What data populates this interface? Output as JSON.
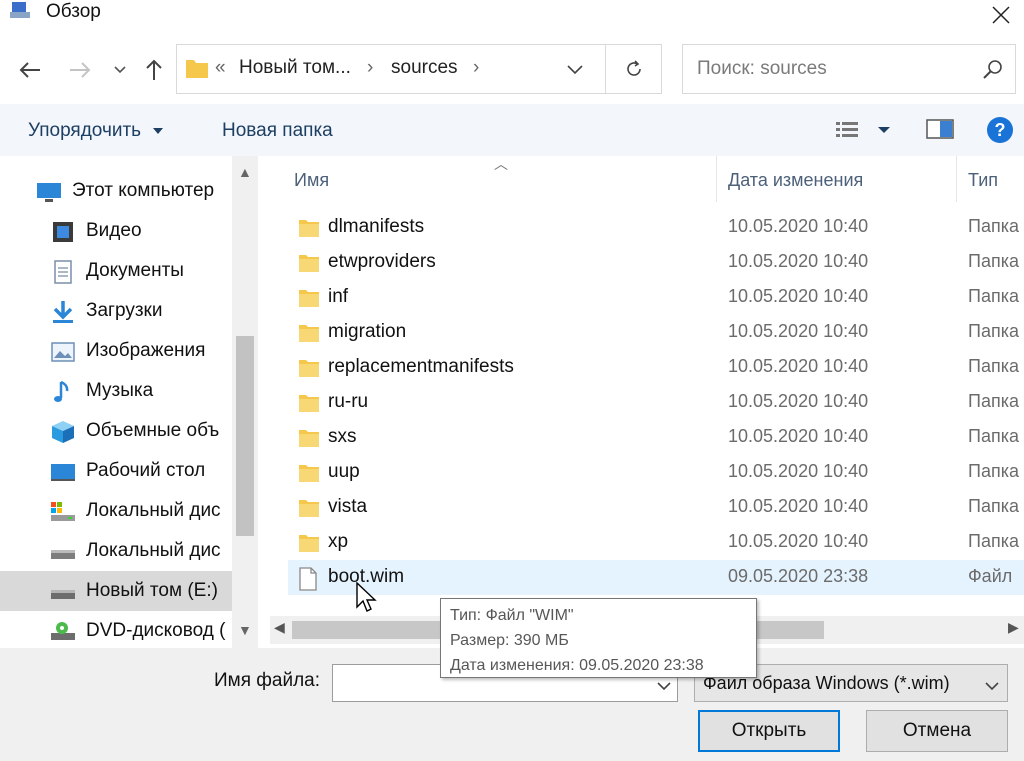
{
  "window": {
    "title": "Обзор"
  },
  "address": {
    "overflow": "«",
    "crumbs": [
      "Новый том...",
      "sources"
    ]
  },
  "search": {
    "placeholder": "Поиск: sources"
  },
  "toolbar": {
    "organize_label": "Упорядочить",
    "new_folder_label": "Новая папка"
  },
  "sidebar": {
    "items": [
      {
        "label": "Этот компьютер",
        "icon": "computer-icon"
      },
      {
        "label": "Видео",
        "icon": "video-icon"
      },
      {
        "label": "Документы",
        "icon": "documents-icon"
      },
      {
        "label": "Загрузки",
        "icon": "downloads-icon"
      },
      {
        "label": "Изображения",
        "icon": "pictures-icon"
      },
      {
        "label": "Музыка",
        "icon": "music-icon"
      },
      {
        "label": "Объемные объ",
        "icon": "3d-objects-icon"
      },
      {
        "label": "Рабочий стол",
        "icon": "desktop-icon"
      },
      {
        "label": "Локальный дис",
        "icon": "local-disk-icon"
      },
      {
        "label": "Локальный дис",
        "icon": "local-disk-icon"
      },
      {
        "label": "Новый том (E:)",
        "icon": "drive-icon",
        "selected": true
      },
      {
        "label": "DVD-дисковод (",
        "icon": "dvd-drive-icon"
      }
    ]
  },
  "columns": {
    "name": "Имя",
    "date": "Дата изменения",
    "type": "Тип"
  },
  "files": [
    {
      "name": "dlmanifests",
      "date": "10.05.2020 10:40",
      "type": "Папка",
      "kind": "folder"
    },
    {
      "name": "etwproviders",
      "date": "10.05.2020 10:40",
      "type": "Папка",
      "kind": "folder"
    },
    {
      "name": "inf",
      "date": "10.05.2020 10:40",
      "type": "Папка",
      "kind": "folder"
    },
    {
      "name": "migration",
      "date": "10.05.2020 10:40",
      "type": "Папка",
      "kind": "folder"
    },
    {
      "name": "replacementmanifests",
      "date": "10.05.2020 10:40",
      "type": "Папка",
      "kind": "folder"
    },
    {
      "name": "ru-ru",
      "date": "10.05.2020 10:40",
      "type": "Папка",
      "kind": "folder"
    },
    {
      "name": "sxs",
      "date": "10.05.2020 10:40",
      "type": "Папка",
      "kind": "folder"
    },
    {
      "name": "uup",
      "date": "10.05.2020 10:40",
      "type": "Папка",
      "kind": "folder"
    },
    {
      "name": "vista",
      "date": "10.05.2020 10:40",
      "type": "Папка",
      "kind": "folder"
    },
    {
      "name": "xp",
      "date": "10.05.2020 10:40",
      "type": "Папка",
      "kind": "folder"
    },
    {
      "name": "boot.wim",
      "date": "09.05.2020 23:38",
      "type": "Файл",
      "kind": "file",
      "hover": true
    }
  ],
  "tooltip": {
    "type": "Тип: Файл \"WIM\"",
    "size": "Размер: 390 МБ",
    "modified": "Дата изменения: 09.05.2020 23:38"
  },
  "bottom": {
    "filename_label": "Имя файла:",
    "filename_value": "",
    "filter_value": "Файл образа Windows (*.wim)",
    "open_label": "Открыть",
    "cancel_label": "Отмена"
  },
  "colors": {
    "accent": "#0078d7",
    "folder": "#f5c84c",
    "toolbar_bg": "#f3f6fb",
    "hover": "#e5f3ff"
  }
}
